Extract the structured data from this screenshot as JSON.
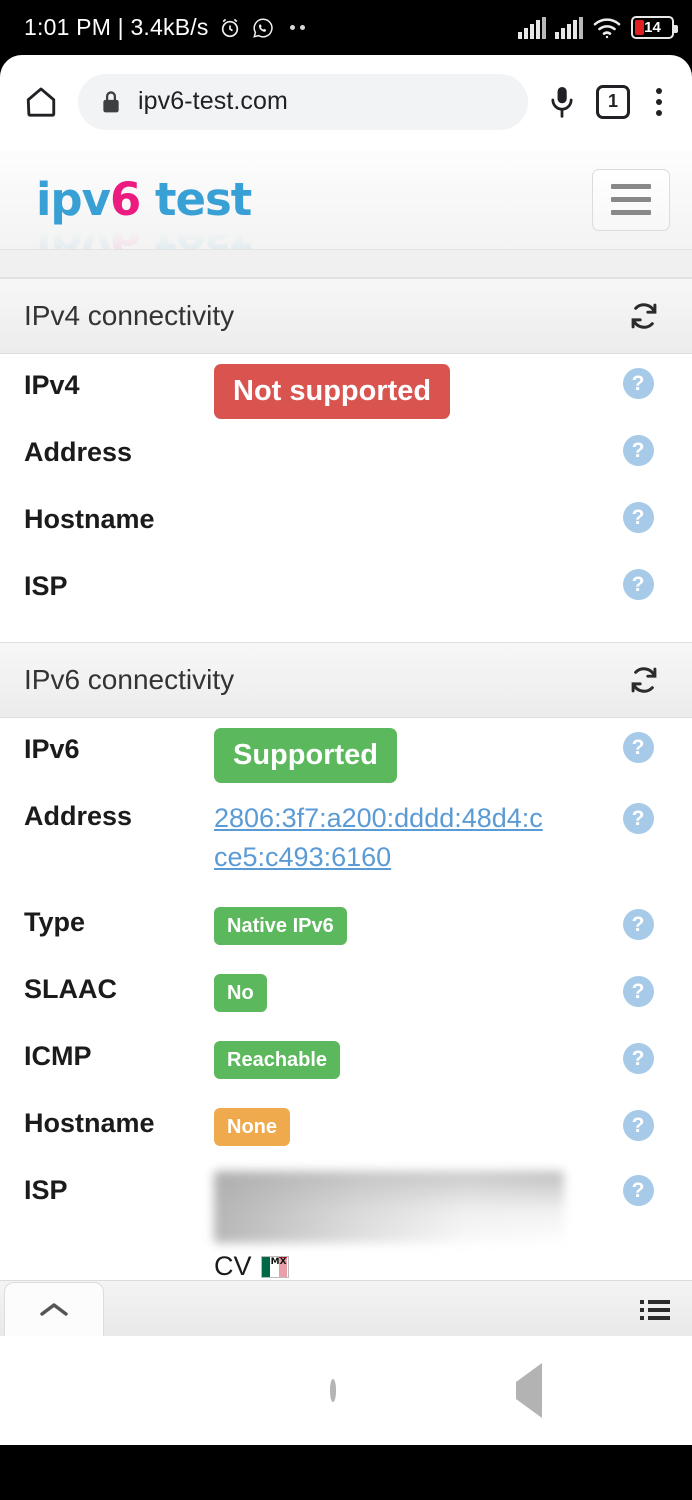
{
  "status_bar": {
    "time": "1:01 PM",
    "separator": "|",
    "network_speed": "3.4kB/s",
    "icons": [
      "alarm-clock-icon",
      "whatsapp-icon",
      "more-notifications-dots"
    ],
    "signal_1": "signal-bars-icon",
    "signal_2": "signal-bars-icon",
    "wifi": "wifi-icon",
    "battery_level": "14"
  },
  "browser": {
    "home_icon": "home-icon",
    "lock_icon": "lock-icon",
    "url": "ipv6-test.com",
    "mic_icon": "microphone-icon",
    "tab_count": "1",
    "menu_icon": "overflow-menu-icon"
  },
  "site": {
    "logo_part1": "ipv",
    "logo_part2": "6",
    "logo_part3": " test",
    "logo_blue": "#38a0d4",
    "logo_pink": "#ec1b80",
    "menu_button_icon": "hamburger-menu-icon"
  },
  "sections": [
    {
      "title": "IPv4 connectivity",
      "refresh_icon": "refresh-icon",
      "rows": [
        {
          "label": "IPv4",
          "badge": "Not supported",
          "badge_color": "#d9534f",
          "badge_size": "big",
          "help": "?"
        },
        {
          "label": "Address",
          "badge": "",
          "help": "?"
        },
        {
          "label": "Hostname",
          "badge": "",
          "help": "?"
        },
        {
          "label": "ISP",
          "badge": "",
          "help": "?"
        }
      ]
    },
    {
      "title": "IPv6 connectivity",
      "refresh_icon": "refresh-icon",
      "rows": [
        {
          "label": "IPv6",
          "badge": "Supported",
          "badge_color": "#5cb85c",
          "badge_size": "big",
          "help": "?"
        },
        {
          "label": "Address",
          "link": "2806:3f7:a200:dddd:48d4:cce5:c493:6160",
          "link_color": "#5b9bd5",
          "help": "?"
        },
        {
          "label": "Type",
          "badge": "Native IPv6",
          "badge_color": "#5cb85c",
          "badge_size": "small",
          "help": "?"
        },
        {
          "label": "SLAAC",
          "badge": "No",
          "badge_color": "#5cb85c",
          "badge_size": "small",
          "help": "?"
        },
        {
          "label": "ICMP",
          "badge": "Reachable",
          "badge_color": "#5cb85c",
          "badge_size": "small",
          "help": "?"
        },
        {
          "label": "Hostname",
          "badge": "None",
          "badge_color": "#efaa4e",
          "badge_size": "small",
          "help": "?"
        },
        {
          "label": "ISP",
          "redacted": true,
          "country_code": "CV",
          "flag": "mexico-flag-icon",
          "flag_label": "MX",
          "help": "?"
        }
      ]
    }
  ],
  "bottom_panel": {
    "collapse_icon": "chevron-up-icon",
    "list_icon": "list-view-icon"
  },
  "android_nav": {
    "recents_icon": "square-recents-icon",
    "home_icon": "circle-home-icon",
    "back_icon": "triangle-back-icon"
  }
}
